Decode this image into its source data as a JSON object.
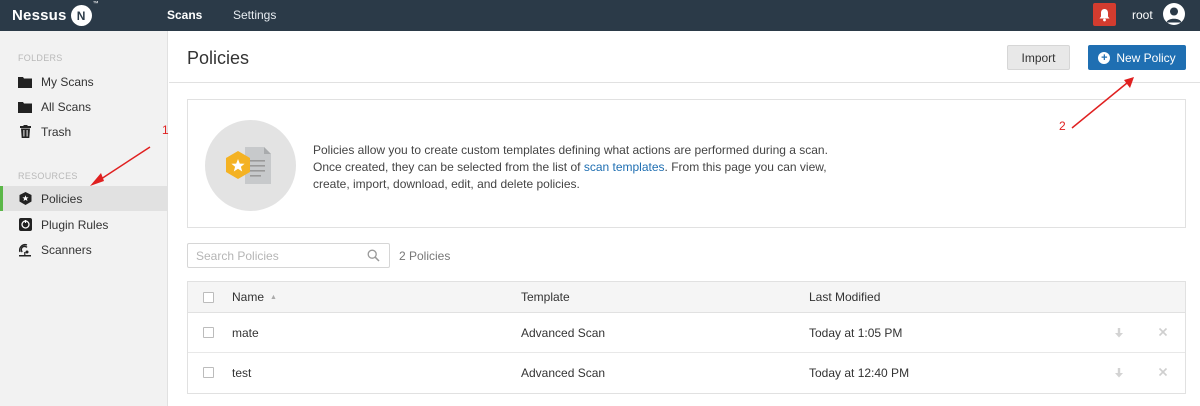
{
  "app": {
    "logo_text": "Nessus",
    "logo_badge": "N"
  },
  "topnav": {
    "items": [
      {
        "label": "Scans",
        "active": true
      },
      {
        "label": "Settings",
        "active": false
      }
    ],
    "user": "root"
  },
  "sidebar": {
    "folders_heading": "FOLDERS",
    "folders": [
      {
        "label": "My Scans",
        "icon": "folder-icon"
      },
      {
        "label": "All Scans",
        "icon": "folder-icon"
      },
      {
        "label": "Trash",
        "icon": "trash-icon"
      }
    ],
    "resources_heading": "RESOURCES",
    "resources": [
      {
        "label": "Policies",
        "icon": "shield-icon",
        "active": true
      },
      {
        "label": "Plugin Rules",
        "icon": "plugin-icon"
      },
      {
        "label": "Scanners",
        "icon": "scanner-icon"
      }
    ]
  },
  "page": {
    "title": "Policies",
    "import_label": "Import",
    "new_policy_label": "New Policy"
  },
  "info": {
    "text_before_link": "Policies allow you to create custom templates defining what actions are performed during a scan. Once created, they can be selected from the list of ",
    "link_text": "scan templates",
    "text_after_link": ". From this page you can view, create, import, download, edit, and delete policies."
  },
  "search": {
    "placeholder": "Search Policies",
    "count_label": "2 Policies"
  },
  "table": {
    "columns": [
      "Name",
      "Template",
      "Last Modified"
    ],
    "rows": [
      {
        "name": "mate",
        "template": "Advanced Scan",
        "modified": "Today at 1:05 PM"
      },
      {
        "name": "test",
        "template": "Advanced Scan",
        "modified": "Today at 12:40 PM"
      }
    ]
  },
  "annotations": {
    "label_1": "1",
    "label_2": "2"
  },
  "colors": {
    "topbar": "#2b3a48",
    "accent_blue": "#1f6fb2",
    "active_green": "#5bb748",
    "alert_red": "#d33c2f",
    "annotation_red": "#e02020"
  }
}
